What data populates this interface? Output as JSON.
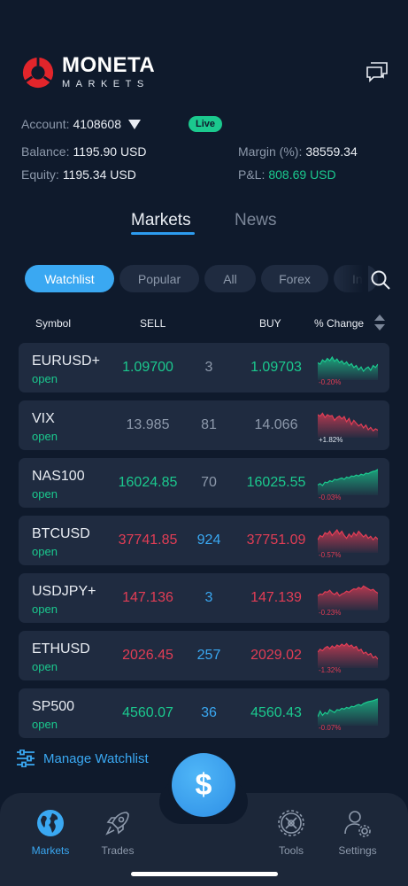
{
  "app": {
    "brand_title": "MONETA",
    "brand_subtitle": "MARKETS"
  },
  "account": {
    "label": "Account:",
    "number": "4108608",
    "status_badge": "Live",
    "balance_label": "Balance:",
    "balance_value": "1195.90 USD",
    "equity_label": "Equity:",
    "equity_value": "1195.34 USD",
    "margin_label": "Margin (%):",
    "margin_value": "38559.34",
    "pnl_label": "P&L:",
    "pnl_value": "808.69 USD"
  },
  "main_tabs": [
    {
      "label": "Markets",
      "active": true
    },
    {
      "label": "News",
      "active": false
    }
  ],
  "filters": [
    {
      "label": "Watchlist",
      "active": true
    },
    {
      "label": "Popular",
      "active": false
    },
    {
      "label": "All",
      "active": false
    },
    {
      "label": "Forex",
      "active": false
    },
    {
      "label": "In",
      "active": false
    }
  ],
  "columns": {
    "symbol": "Symbol",
    "sell": "SELL",
    "buy": "BUY",
    "change": "% Change"
  },
  "rows": [
    {
      "symbol": "EURUSD+",
      "status": "open",
      "sell": "1.09700",
      "spread": "3",
      "buy": "1.09703",
      "change": "-0.20%",
      "price_color": "green",
      "spread_color": "gray",
      "change_color": "red",
      "trend": "green",
      "spark": [
        0.45,
        0.5,
        0.35,
        0.42,
        0.3,
        0.38,
        0.25,
        0.4,
        0.32,
        0.45,
        0.38,
        0.5,
        0.42,
        0.55,
        0.48,
        0.62,
        0.55,
        0.7,
        0.6,
        0.75,
        0.65,
        0.6,
        0.72,
        0.55,
        0.62,
        0.5
      ]
    },
    {
      "symbol": "VIX",
      "status": "open",
      "sell": "13.985",
      "spread": "81",
      "buy": "14.066",
      "change": "+1.82%",
      "price_color": "gray",
      "spread_color": "gray",
      "change_color": "white",
      "trend": "red",
      "spark": [
        0.25,
        0.3,
        0.2,
        0.35,
        0.25,
        0.3,
        0.28,
        0.45,
        0.35,
        0.3,
        0.4,
        0.32,
        0.5,
        0.38,
        0.6,
        0.45,
        0.55,
        0.65,
        0.58,
        0.72,
        0.62,
        0.78,
        0.7,
        0.82,
        0.75,
        0.8
      ]
    },
    {
      "symbol": "NAS100",
      "status": "open",
      "sell": "16024.85",
      "spread": "70",
      "buy": "16025.55",
      "change": "-0.03%",
      "price_color": "green",
      "spread_color": "gray",
      "change_color": "red",
      "trend": "green",
      "spark": [
        0.7,
        0.65,
        0.72,
        0.6,
        0.62,
        0.55,
        0.58,
        0.5,
        0.52,
        0.48,
        0.45,
        0.5,
        0.42,
        0.45,
        0.38,
        0.4,
        0.35,
        0.38,
        0.32,
        0.35,
        0.28,
        0.3,
        0.25,
        0.22,
        0.2,
        0.15
      ]
    },
    {
      "symbol": "BTCUSD",
      "status": "open",
      "sell": "37741.85",
      "spread": "924",
      "buy": "37751.09",
      "change": "-0.57%",
      "price_color": "red",
      "spread_color": "blue",
      "change_color": "red",
      "trend": "red",
      "spark": [
        0.6,
        0.45,
        0.5,
        0.35,
        0.4,
        0.3,
        0.45,
        0.35,
        0.25,
        0.4,
        0.3,
        0.45,
        0.55,
        0.4,
        0.5,
        0.35,
        0.45,
        0.3,
        0.4,
        0.5,
        0.42,
        0.55,
        0.48,
        0.6,
        0.5,
        0.58
      ]
    },
    {
      "symbol": "USDJPY+",
      "status": "open",
      "sell": "147.136",
      "spread": "3",
      "buy": "147.139",
      "change": "-0.23%",
      "price_color": "red",
      "spread_color": "blue",
      "change_color": "red",
      "trend": "red",
      "spark": [
        0.55,
        0.48,
        0.5,
        0.4,
        0.42,
        0.35,
        0.45,
        0.5,
        0.42,
        0.55,
        0.48,
        0.45,
        0.38,
        0.42,
        0.35,
        0.3,
        0.32,
        0.25,
        0.3,
        0.2,
        0.25,
        0.3,
        0.35,
        0.32,
        0.4,
        0.45
      ]
    },
    {
      "symbol": "ETHUSD",
      "status": "open",
      "sell": "2026.45",
      "spread": "257",
      "buy": "2029.02",
      "change": "-1.32%",
      "price_color": "red",
      "spread_color": "blue",
      "change_color": "red",
      "trend": "red",
      "spark": [
        0.5,
        0.4,
        0.45,
        0.35,
        0.3,
        0.38,
        0.28,
        0.35,
        0.25,
        0.3,
        0.22,
        0.28,
        0.2,
        0.3,
        0.25,
        0.35,
        0.3,
        0.45,
        0.4,
        0.55,
        0.5,
        0.6,
        0.55,
        0.7,
        0.65,
        0.75
      ]
    },
    {
      "symbol": "SP500",
      "status": "open",
      "sell": "4560.07",
      "spread": "36",
      "buy": "4560.43",
      "change": "-0.07%",
      "price_color": "green",
      "spread_color": "blue",
      "change_color": "red",
      "trend": "green",
      "spark": [
        0.75,
        0.55,
        0.7,
        0.6,
        0.65,
        0.5,
        0.55,
        0.6,
        0.5,
        0.52,
        0.45,
        0.48,
        0.42,
        0.45,
        0.38,
        0.4,
        0.35,
        0.32,
        0.35,
        0.28,
        0.25,
        0.22,
        0.2,
        0.18,
        0.15,
        0.12
      ]
    }
  ],
  "manage_watchlist": "Manage Watchlist",
  "fab_symbol": "$",
  "bottom_nav": [
    {
      "label": "Markets",
      "icon": "globe-icon",
      "active": true
    },
    {
      "label": "Trades",
      "icon": "rocket-icon",
      "active": false
    },
    {
      "label": "Tools",
      "icon": "tools-icon",
      "active": false
    },
    {
      "label": "Settings",
      "icon": "user-settings-icon",
      "active": false
    }
  ],
  "colors": {
    "background": "#0f1a2c",
    "card": "#1f2b40",
    "accent_blue": "#3aa8f2",
    "green": "#1bc98e",
    "red": "#e23d55"
  }
}
